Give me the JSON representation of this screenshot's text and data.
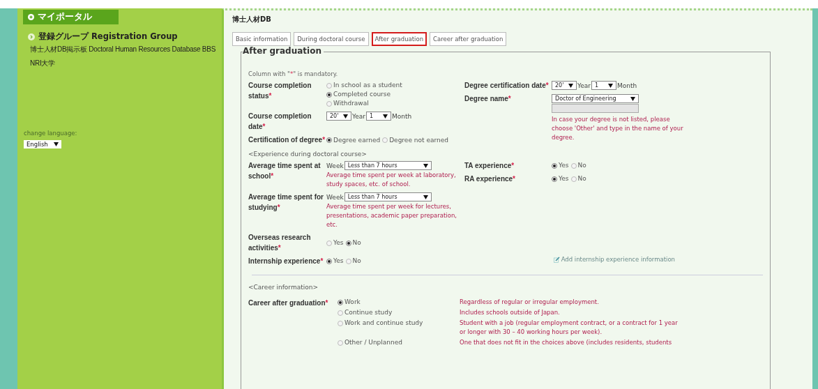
{
  "sidebar": {
    "header": "マイポータル",
    "group": "登録グループ Registration Group",
    "links": [
      "博士人材DB掲示板 Doctoral Human Resources Database BBS",
      "NRI大学"
    ],
    "language_label": "change language:",
    "language": "English"
  },
  "app_title": "博士人材DB",
  "tabs": [
    {
      "label": "Basic information",
      "selected": false
    },
    {
      "label": "During doctoral course",
      "selected": false
    },
    {
      "label": "After graduation",
      "selected": true
    },
    {
      "label": "Career after graduation",
      "selected": false
    }
  ],
  "section_title": "After graduation",
  "note": {
    "before": "Column with \"",
    "mark": "*",
    "after": "\" is mandatory."
  },
  "completion": {
    "left": [
      {
        "kind": "radio_list",
        "label": "Course completion status",
        "mark": "*",
        "options": [
          {
            "label": "In school as a student",
            "selected": false
          },
          {
            "label": "Completed course",
            "selected": true
          },
          {
            "label": "Withdrawal",
            "selected": false
          }
        ]
      },
      {
        "kind": "date",
        "label": "Course completion date",
        "mark": "*",
        "year": "20'",
        "year_unit": "Year",
        "month": "1",
        "month_unit": "Month"
      },
      {
        "kind": "radio",
        "label": "Certification of degree",
        "mark": "*",
        "options": [
          {
            "label": "Degree earned",
            "selected": true
          },
          {
            "label": "Degree not earned",
            "selected": false
          }
        ]
      }
    ],
    "right": [
      {
        "kind": "date",
        "label": "Degree certification date",
        "mark": "*",
        "year": "20'",
        "year_unit": "Year",
        "month": "1",
        "month_unit": "Month"
      },
      {
        "kind": "degree",
        "label": "Degree name",
        "mark": "*",
        "value": "Doctor of Engineering",
        "other_disabled": true,
        "hint": "In case your degree is not listed, please choose 'Other' and type in the name of your degree."
      }
    ]
  },
  "experience_heading": "<Experience during doctoral course>",
  "experience": {
    "left": [
      {
        "kind": "week",
        "label": "Average time spent at school",
        "mark": "*",
        "prefix": "Week",
        "value": "Less than 7 hours",
        "hint": "Average time spent per week at laboratory, study spaces, etc. of school."
      },
      {
        "kind": "week",
        "label": "Average time spent for studying",
        "mark": "*",
        "prefix": "Week",
        "value": "Less than 7 hours",
        "hint": "Average time spent per week for lectures, presentations, academic paper preparation, etc."
      },
      {
        "kind": "radio",
        "label": "Overseas research activities",
        "mark": "*",
        "options": [
          {
            "label": "Yes",
            "selected": false
          },
          {
            "label": "No",
            "selected": true
          }
        ]
      },
      {
        "kind": "radio",
        "label": "Internship experience",
        "mark": "*",
        "options": [
          {
            "label": "Yes",
            "selected": true
          },
          {
            "label": "No",
            "selected": false
          }
        ],
        "link": "Add internship experience information"
      }
    ],
    "right": [
      {
        "kind": "radio",
        "label": "TA experience",
        "mark": "*",
        "options": [
          {
            "label": "Yes",
            "selected": true
          },
          {
            "label": "No",
            "selected": false
          }
        ]
      },
      {
        "kind": "radio",
        "label": "RA experience",
        "mark": "*",
        "options": [
          {
            "label": "Yes",
            "selected": true
          },
          {
            "label": "No",
            "selected": false
          }
        ]
      }
    ]
  },
  "career_heading": "<Career information>",
  "career": {
    "label": "Career after graduation",
    "mark": "*",
    "options": [
      {
        "label": "Work",
        "selected": true,
        "hint": "Regardless of regular or irregular employment."
      },
      {
        "label": "Continue study",
        "selected": false,
        "hint": "Includes schools outside of Japan."
      },
      {
        "label": "Work and continue study",
        "selected": false,
        "hint": "Student with a job (regular employment contract, or a contract for 1 year or longer with 30 – 40 working hours per week)."
      },
      {
        "label": "Other / Unplanned",
        "selected": false,
        "hint": "One that does not fit in the choices above (includes residents, students"
      }
    ]
  }
}
